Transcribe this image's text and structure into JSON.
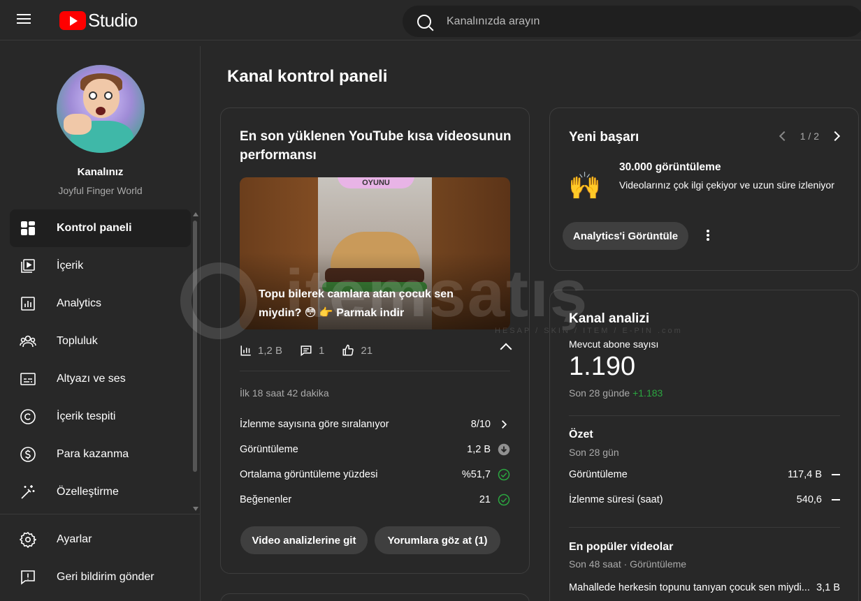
{
  "header": {
    "logo_text": "Studio",
    "search_placeholder": "Kanalınızda arayın"
  },
  "sidebar": {
    "channel_name": "Kanalınız",
    "channel_handle": "Joyful Finger World",
    "items": [
      {
        "label": "Kontrol paneli",
        "icon": "dashboard-icon"
      },
      {
        "label": "İçerik",
        "icon": "content-icon"
      },
      {
        "label": "Analytics",
        "icon": "analytics-icon"
      },
      {
        "label": "Topluluk",
        "icon": "community-icon"
      },
      {
        "label": "Altyazı ve ses",
        "icon": "subtitles-icon"
      },
      {
        "label": "İçerik tespiti",
        "icon": "copyright-icon"
      },
      {
        "label": "Para kazanma",
        "icon": "monetization-icon"
      },
      {
        "label": "Özelleştirme",
        "icon": "customization-icon"
      }
    ],
    "bottom_items": [
      {
        "label": "Ayarlar",
        "icon": "settings-icon"
      },
      {
        "label": "Geri bildirim gönder",
        "icon": "feedback-icon"
      }
    ]
  },
  "main": {
    "page_title": "Kanal kontrol paneli",
    "latest_short": {
      "title": "En son yüklenen YouTube kısa videosunun performansı",
      "thumb_label": "OYUNU",
      "caption": "Topu bilerek camlara atan çocuk sen miydin? 😳 👉 Parmak indir",
      "views": "1,2 B",
      "comments": "1",
      "likes": "21",
      "period": "İlk 18 saat 42 dakika",
      "metrics": [
        {
          "label": "İzlenme sayısına göre sıralanıyor",
          "value": "8/10",
          "icon": "chevron-right-icon"
        },
        {
          "label": "Görüntüleme",
          "value": "1,2 B",
          "icon": "arrow-down-circle-icon"
        },
        {
          "label": "Ortalama görüntüleme yüzdesi",
          "value": "%51,7",
          "icon": "check-circle-icon"
        },
        {
          "label": "Beğenenler",
          "value": "21",
          "icon": "check-circle-icon"
        }
      ],
      "btn_analytics": "Video analizlerine git",
      "btn_comments": "Yorumlara göz at (1)"
    },
    "achievement": {
      "title": "Yeni başarı",
      "pager": "1 / 2",
      "emoji": "🙌",
      "headline": "30.000 görüntüleme",
      "desc": "Videolarınız çok ilgi çekiyor ve uzun süre izleniyor",
      "btn": "Analytics'i Görüntüle"
    },
    "analytics": {
      "title": "Kanal analizi",
      "subs_label": "Mevcut abone sayısı",
      "subs_value": "1.190",
      "subs_period": "Son 28 günde",
      "subs_change": "+1.183",
      "summary_title": "Özet",
      "summary_period": "Son 28 gün",
      "rows": [
        {
          "label": "Görüntüleme",
          "value": "117,4 B"
        },
        {
          "label": "İzlenme süresi (saat)",
          "value": "540,6"
        }
      ],
      "top_title": "En popüler videolar",
      "top_period": "Son 48 saat · Görüntüleme",
      "top_video": {
        "title": "Mahallede herkesin topunu tanıyan çocuk sen miydi...",
        "value": "3,1 B"
      }
    }
  },
  "watermark": {
    "text": "itemsatış",
    "sub": "HESAP / SKIN / ITEM / E-PIN .com"
  },
  "colors": {
    "background": "#282828",
    "brand_red": "#ff0000",
    "positive_green": "#2ba640"
  }
}
